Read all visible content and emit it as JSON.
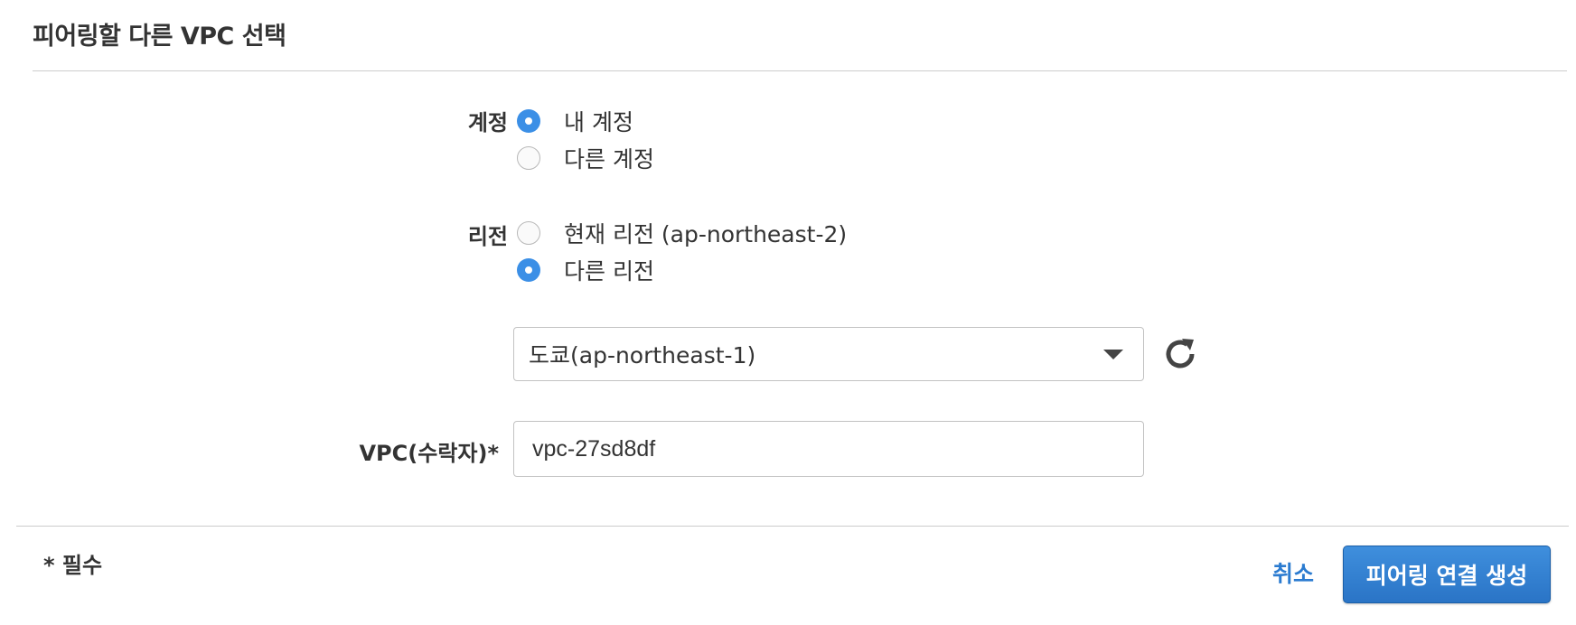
{
  "section": {
    "title": "피어링할 다른 VPC 선택"
  },
  "account": {
    "label": "계정",
    "options": [
      {
        "label": "내 계정",
        "selected": true
      },
      {
        "label": "다른 계정",
        "selected": false
      }
    ]
  },
  "region": {
    "label": "리전",
    "options": [
      {
        "label": "현재 리전 (ap-northeast-2)",
        "selected": false
      },
      {
        "label": "다른 리전",
        "selected": true
      }
    ],
    "select_value": "도쿄(ap-northeast-1)",
    "refresh_icon": "refresh-icon"
  },
  "vpc": {
    "label": "VPC(수락자)*",
    "value": "vpc-27sd8df"
  },
  "footer": {
    "required_note": "* 필수",
    "cancel_label": "취소",
    "create_label": "피어링 연결 생성"
  },
  "colors": {
    "accent": "#3b8fe6",
    "link": "#2b7bd0",
    "primary_button": "#2a74c6",
    "divider": "#cccccc"
  }
}
